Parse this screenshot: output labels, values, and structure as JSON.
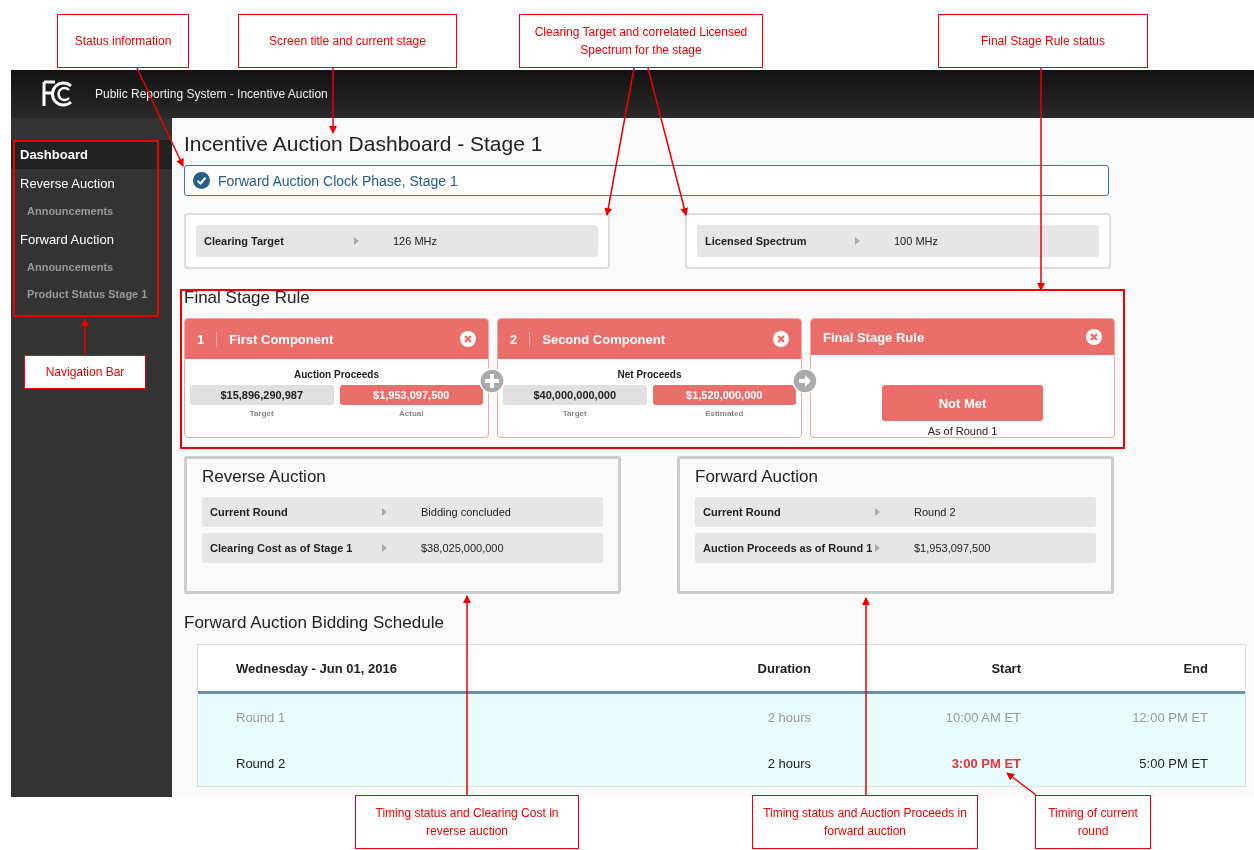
{
  "header": {
    "title": "Public Reporting System - Incentive Auction"
  },
  "sidebar": {
    "items": [
      {
        "label": "Dashboard",
        "kind": "main",
        "selected": true
      },
      {
        "label": "Reverse Auction",
        "kind": "main",
        "selected": false
      },
      {
        "label": "Announcements",
        "kind": "sub",
        "selected": false
      },
      {
        "label": "Forward Auction",
        "kind": "main",
        "selected": false
      },
      {
        "label": "Announcements",
        "kind": "sub",
        "selected": false
      },
      {
        "label": "Product Status Stage 1",
        "kind": "sub",
        "selected": false
      }
    ]
  },
  "page_title": "Incentive Auction Dashboard - Stage 1",
  "status": {
    "text": "Forward Auction Clock Phase, Stage 1",
    "complete": true
  },
  "spectrum": [
    {
      "label": "Clearing Target",
      "value": "126 MHz"
    },
    {
      "label": "Licensed Spectrum",
      "value": "100 MHz"
    }
  ],
  "final_stage_rule": {
    "title": "Final Stage Rule",
    "cards": [
      {
        "kind": "component",
        "number": "1",
        "title": "First Component",
        "met": false,
        "label": "Auction Proceeds",
        "target": "$15,896,290,987",
        "target_caption": "Target",
        "actual": "$1,953,097,500",
        "actual_caption": "Actual"
      },
      {
        "kind": "component",
        "number": "2",
        "title": "Second Component",
        "met": false,
        "label": "Net Proceeds",
        "target": "$40,000,000,000",
        "target_caption": "Target",
        "actual": "$1,520,000,000",
        "actual_caption": "Estimated"
      },
      {
        "kind": "result",
        "title": "Final Stage Rule",
        "met": false,
        "status": "Not Met",
        "note": "As of Round 1"
      }
    ]
  },
  "auctions": [
    {
      "title": "Reverse Auction",
      "rows": [
        {
          "label": "Current Round",
          "value": "Bidding concluded"
        },
        {
          "label": "Clearing Cost as of Stage 1",
          "value": "$38,025,000,000"
        }
      ]
    },
    {
      "title": "Forward Auction",
      "rows": [
        {
          "label": "Current Round",
          "value": "Round 2"
        },
        {
          "label": "Auction Proceeds as of Round 1",
          "value": "$1,953,097,500"
        }
      ]
    }
  ],
  "schedule": {
    "title": "Forward Auction Bidding Schedule",
    "columns": [
      "Wednesday - Jun 01, 2016",
      "Duration",
      "Start",
      "End"
    ],
    "rows": [
      {
        "round": "Round 1",
        "duration": "2 hours",
        "start": "10:00 AM ET",
        "end": "12:00 PM ET",
        "past": true,
        "current": false
      },
      {
        "round": "Round 2",
        "duration": "2 hours",
        "start": "3:00 PM ET",
        "end": "5:00 PM ET",
        "past": false,
        "current": true
      }
    ]
  },
  "annotations": [
    {
      "text": "Status information"
    },
    {
      "text": "Screen title and current stage"
    },
    {
      "text": "Clearing Target and correlated Licensed Spectrum for the stage"
    },
    {
      "text": "Final Stage Rule status"
    },
    {
      "text": "Navigation Bar"
    },
    {
      "text": "Timing status and Clearing Cost in reverse auction"
    },
    {
      "text": "Timing status and Auction Proceeds in forward auction"
    },
    {
      "text": "Timing of current round"
    }
  ]
}
